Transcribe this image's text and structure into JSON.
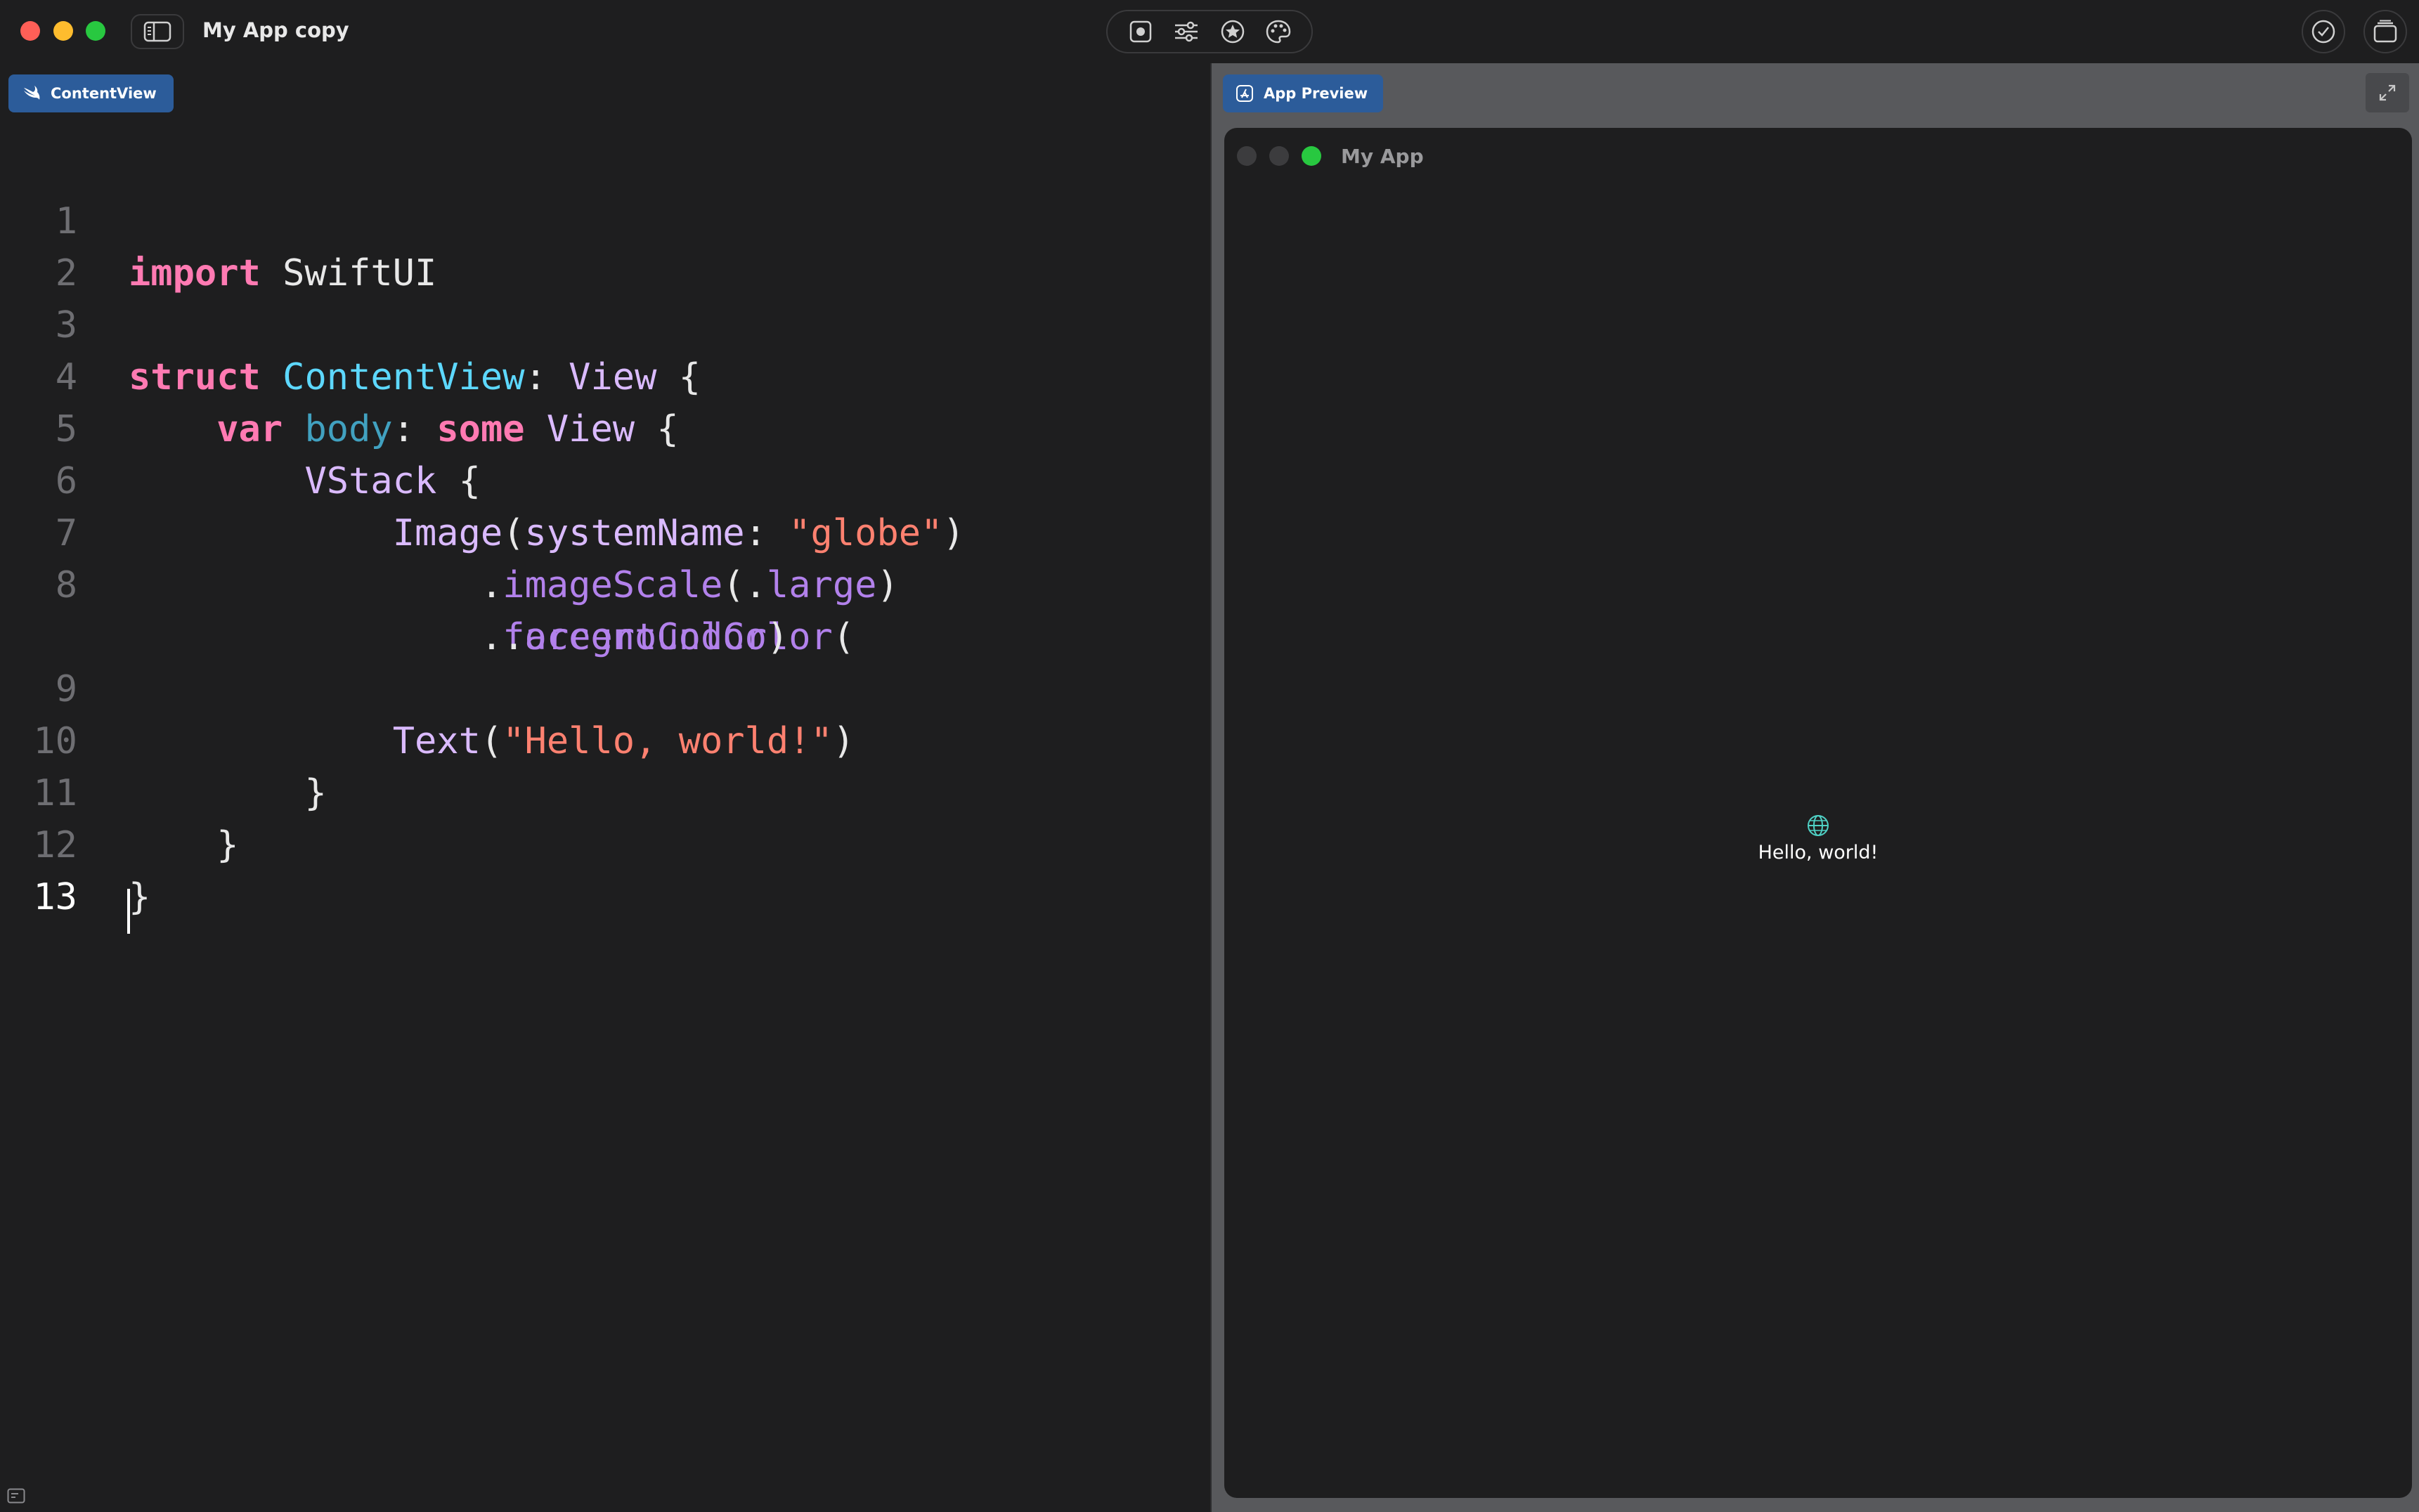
{
  "window": {
    "title": "My App copy"
  },
  "toolbar": {
    "icons": [
      "sidebar-toggle-icon",
      "record-icon",
      "sliders-icon",
      "star-badge-icon",
      "palette-icon",
      "checkmark-circle-icon",
      "stack-icon"
    ]
  },
  "editor": {
    "tab_label": "ContentView",
    "tab_icon": "swift-icon",
    "line_numbers": [
      "1",
      "2",
      "3",
      "4",
      "5",
      "6",
      "7",
      "8",
      "9",
      "10",
      "11",
      "12",
      "13"
    ],
    "lines": [
      "import SwiftUI",
      "",
      "struct ContentView: View {",
      "    var body: some View {",
      "        VStack {",
      "            Image(systemName: \"globe\")",
      "                .imageScale(.large)",
      "                .foregroundColor(",
      "                 .accentColor)",
      "            Text(\"Hello, world!\")",
      "        }",
      "    }",
      "}",
      ""
    ]
  },
  "preview": {
    "tab_label": "App Preview",
    "tab_icon": "app-store-icon",
    "app_window_title": "My App",
    "content_icon": "globe-icon",
    "content_text": "Hello, world!"
  },
  "colors": {
    "accent_tab": "#2c5c9a",
    "keyword": "#ff7ab2",
    "type": "#dabaff",
    "declared_type": "#5dd8ff",
    "property": "#41a1c0",
    "function": "#b281eb",
    "string": "#ff8170",
    "globe": "#4fd1c5"
  }
}
